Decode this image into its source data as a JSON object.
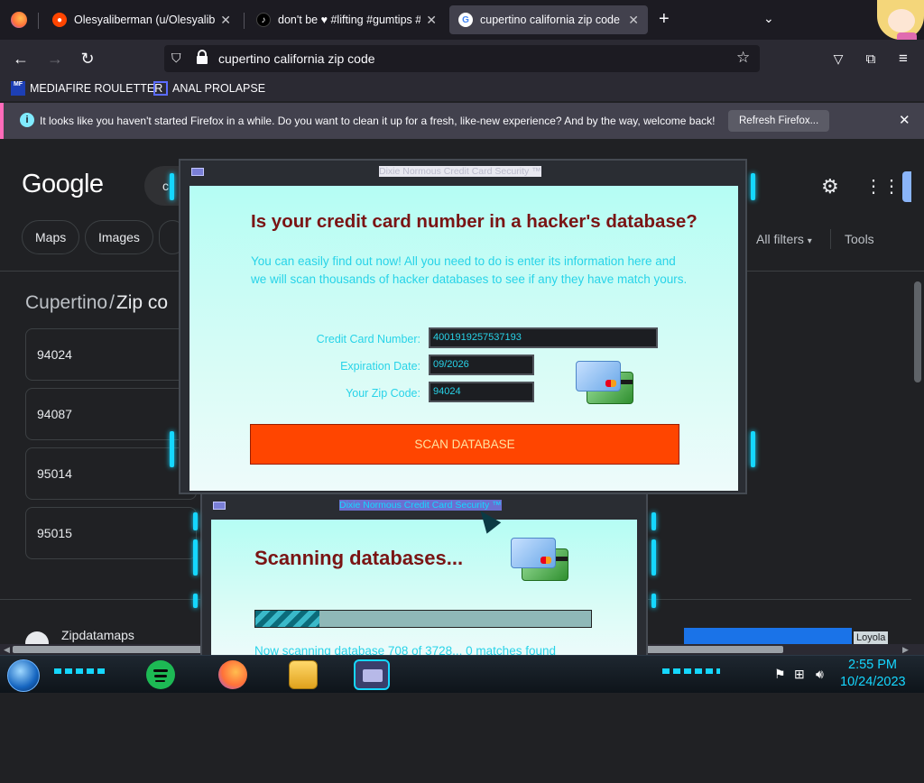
{
  "browser": {
    "tabs": [
      {
        "title": "Olesyaliberman (u/Olesyaliberm",
        "icon": "reddit-icon"
      },
      {
        "title": "don't be ♥ #lifting #gumtips #",
        "icon": "tiktok-icon"
      },
      {
        "title": "cupertino california zip code - (",
        "icon": "google-icon"
      }
    ],
    "new_tab": "+",
    "url": "cupertino california zip code",
    "bookmarks": [
      {
        "label": "MEDIAFIRE ROULETTER",
        "icon_text": "MF"
      },
      {
        "label": "ANAL PROLAPSE"
      }
    ],
    "notice": {
      "message": "It looks like you haven't started Firefox in a while. Do you want to clean it up for a fresh, like-new experience? And by the way, welcome back!",
      "button": "Refresh Firefox..."
    }
  },
  "google": {
    "logo": "Google",
    "search_partial": "c",
    "chips": [
      "Maps",
      "Images"
    ],
    "all_filters": "All filters",
    "tools": "Tools",
    "heading_city": "Cupertino",
    "heading_sep": "/",
    "heading_rest": "Zip co",
    "zips": [
      "94024",
      "94087",
      "95014",
      "95015"
    ],
    "result_site": "Zipdatamaps",
    "right_image_text": "Loyola"
  },
  "popup1": {
    "title": "Dixie Normous Credit Card Security ™",
    "heading": "Is your credit card number in a hacker's database?",
    "intro": "You can easily find out now! All you need to do is enter its information here and we will scan thousands of hacker databases to see if any they have match yours.",
    "labels": {
      "card": "Credit Card Number:",
      "exp": "Expiration Date:",
      "zip": "Your Zip Code:"
    },
    "values": {
      "card": "4001919257537193",
      "exp": "09/2026",
      "zip": "94024"
    },
    "button": "SCAN DATABASE"
  },
  "popup2": {
    "title": "Dixie Normous Credit Card Security ™",
    "heading": "Scanning databases...",
    "progress": 0.19,
    "status": "Now scanning database 708 of 3728...  0 matches found"
  },
  "taskbar": {
    "time": "2:55 PM",
    "date": "10/24/2023",
    "apps": [
      "spotify-icon",
      "firefox-icon",
      "file-explorer-icon",
      "credit-card-app-icon"
    ]
  },
  "colors": {
    "accent_neon": "#15d7ff",
    "scan_button": "#ff4500",
    "heading_red": "#7a1414"
  }
}
